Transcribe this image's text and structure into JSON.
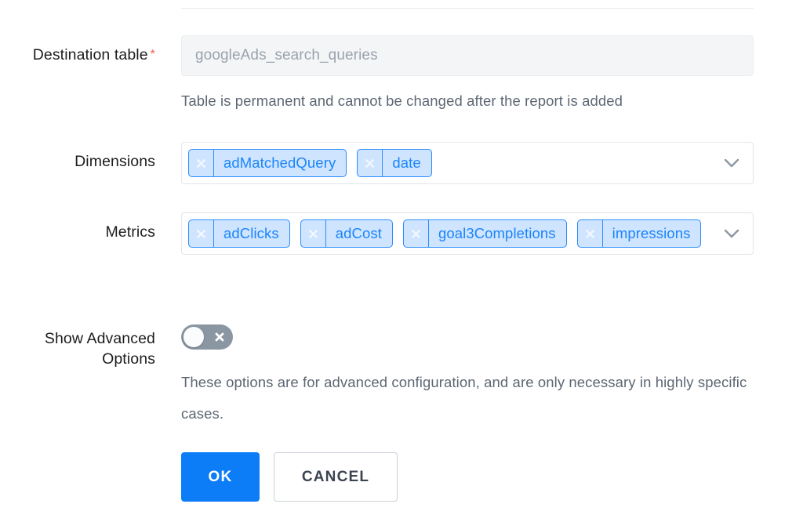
{
  "form": {
    "fields": {
      "destination_table": {
        "label": "Destination table",
        "required_marker": "*",
        "value": "googleAds_search_queries",
        "hint": "Table is permanent and cannot be changed after the report is added"
      },
      "dimensions": {
        "label": "Dimensions",
        "chips": [
          {
            "label": "adMatchedQuery"
          },
          {
            "label": "date"
          }
        ]
      },
      "metrics": {
        "label": "Metrics",
        "chips": [
          {
            "label": "adClicks"
          },
          {
            "label": "adCost"
          },
          {
            "label": "goal3Completions"
          },
          {
            "label": "impressions"
          }
        ]
      },
      "advanced_options": {
        "label_line1": "Show Advanced",
        "label_line2": "Options",
        "state": "off",
        "hint": "These options are for advanced configuration, and are only necessary in highly specific cases."
      }
    },
    "actions": {
      "ok_label": "OK",
      "cancel_label": "CANCEL"
    },
    "colors": {
      "accent_blue": "#0c7cf7",
      "chip_text": "#1a85fb",
      "chip_background": "#cfe4ff",
      "chip_border": "#2b8cfd",
      "required_star": "#f4604f",
      "hint_text": "#5d6773",
      "toggle_track_off": "#8b96a3"
    }
  }
}
